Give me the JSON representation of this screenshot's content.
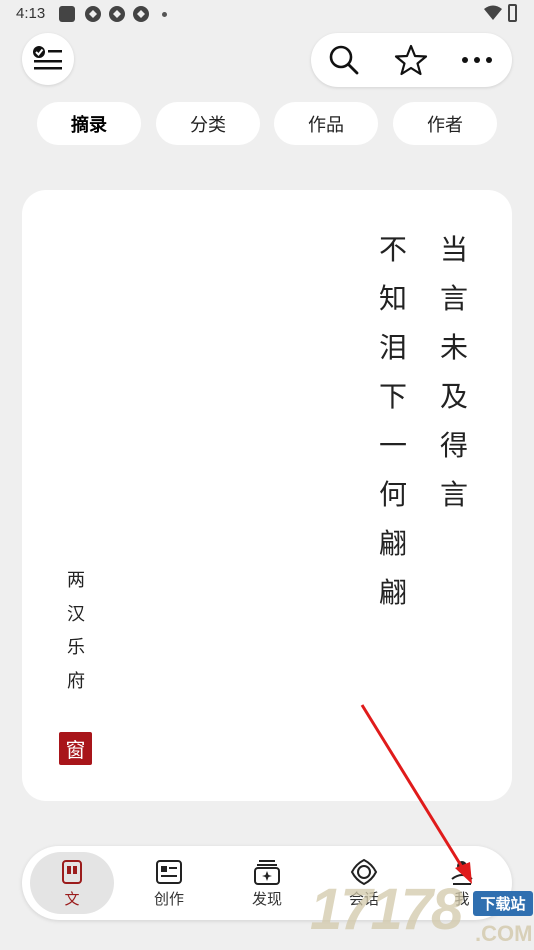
{
  "status_bar": {
    "time": "4:13"
  },
  "filters": [
    {
      "label": "摘录",
      "active": true
    },
    {
      "label": "分类",
      "active": false
    },
    {
      "label": "作品",
      "active": false
    },
    {
      "label": "作者",
      "active": false
    }
  ],
  "card": {
    "verse_col1": [
      "当",
      "言",
      "未",
      "及",
      "得",
      "言"
    ],
    "verse_col2": [
      "不",
      "知",
      "泪",
      "下",
      "一",
      "何",
      "翩",
      "翩"
    ],
    "source": [
      "两",
      "汉",
      "乐",
      "府"
    ],
    "seal": "窗"
  },
  "nav": [
    {
      "label": "文",
      "active": true
    },
    {
      "label": "创作",
      "active": false
    },
    {
      "label": "发现",
      "active": false
    },
    {
      "label": "会话",
      "active": false
    },
    {
      "label": "我",
      "active": false
    }
  ],
  "watermark": {
    "digits": "17178",
    "tag": "下载站",
    "suffix": ".COM"
  },
  "colors": {
    "accent": "#9b1c1c",
    "seal": "#a8151a",
    "arrow": "#e01b1b"
  }
}
